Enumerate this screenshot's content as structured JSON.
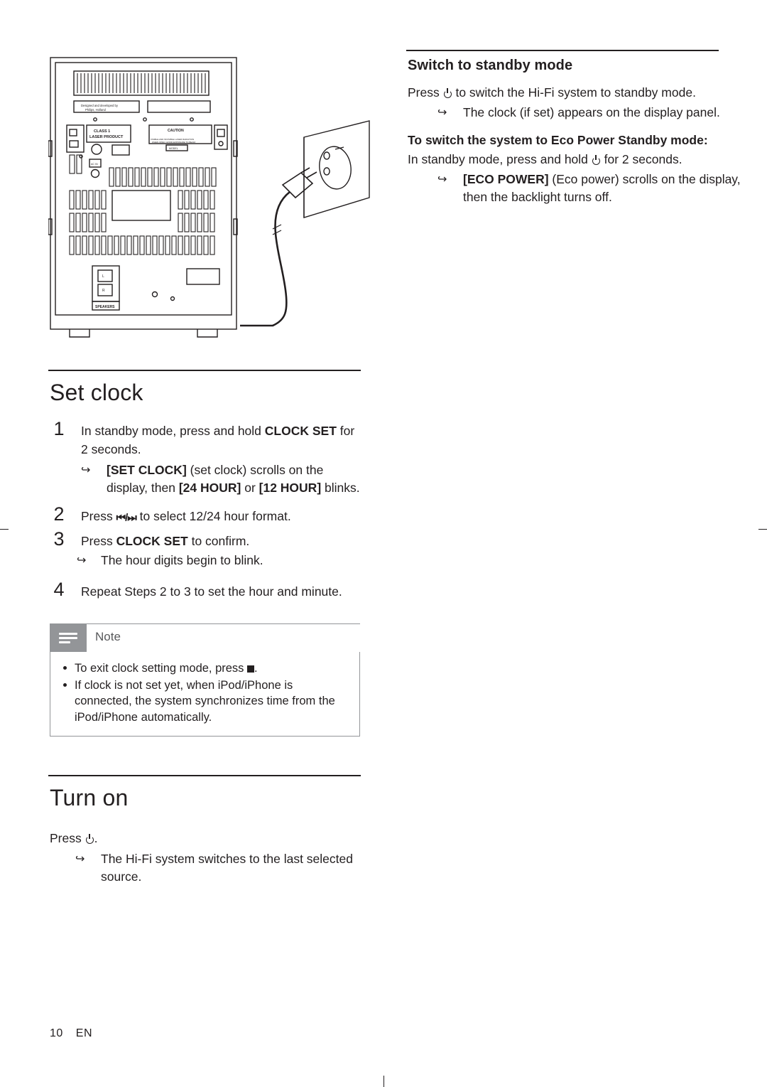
{
  "page": {
    "number": "10",
    "language": "EN"
  },
  "illustration": {
    "name": "rear-panel-power-connection-diagram",
    "labels": {
      "designed": "Designed and developed by",
      "designed2": "Philips, Holland",
      "class1": "CLASS 1",
      "class1b": "LASER PRODUCT",
      "caution": "CAUTION",
      "caution2": "VISIBLE AND INVISIBLE LASER RADIATION WHEN OPEN. AVOID EXPOSURE TO BEAM.",
      "speakers": "SPEAKERS",
      "acin": "AC~ MAINS",
      "left": "L",
      "right": "R"
    }
  },
  "left_column": {
    "set_clock": {
      "title": "Set clock",
      "steps": [
        {
          "num": "1",
          "text_pre": "In standby mode, press and hold ",
          "text_bold": "CLOCK SET",
          "text_post": " for 2 seconds.",
          "subs": [
            {
              "pre": "",
              "bold": "[SET CLOCK]",
              "mid": " (set clock) scrolls on the display, then ",
              "bold2": "[24 HOUR]",
              "mid2": " or ",
              "bold3": "[12 HOUR]",
              "post": " blinks."
            }
          ]
        },
        {
          "num": "2",
          "text_pre": "Press ",
          "text_bold": "",
          "text_post": " to select 12/24 hour format.",
          "buttons": "⏮/⏭"
        },
        {
          "num": "3",
          "text_pre": "Press ",
          "text_bold": "CLOCK SET",
          "text_post": " to confirm.",
          "subs": [
            {
              "plain": "The hour digits begin to blink."
            }
          ]
        },
        {
          "num": "4",
          "text_pre": "Repeat Steps 2 to 3 to set the hour and minute.",
          "text_bold": "",
          "text_post": ""
        }
      ],
      "note": {
        "label": "Note",
        "items": [
          {
            "pre": "To exit clock setting mode, press ",
            "post": "."
          },
          {
            "pre": "If clock is not set yet, when iPod/iPhone is connected, the system synchronizes time from the iPod/iPhone automatically.",
            "post": ""
          }
        ]
      }
    },
    "turn_on": {
      "title": "Turn on",
      "press_label": "Press",
      "sub": "The Hi-Fi system switches to the last selected source."
    }
  },
  "right_column": {
    "standby": {
      "title": "Switch to standby mode",
      "para1_pre": "Press ",
      "para1_post": " to switch the Hi-Fi system to standby mode.",
      "sub1": "The clock (if set) appears on the display panel.",
      "subtitle": "To switch the system to Eco Power Standby mode:",
      "para2_pre": "In standby mode, press and hold ",
      "para2_post": " for 2 seconds.",
      "sub2_bold": "[ECO POWER]",
      "sub2_rest": " (Eco power) scrolls on the display, then the backlight turns off."
    }
  },
  "colors": {
    "text": "#231f20",
    "rule": "#231f20",
    "note_gray": "#939598"
  }
}
